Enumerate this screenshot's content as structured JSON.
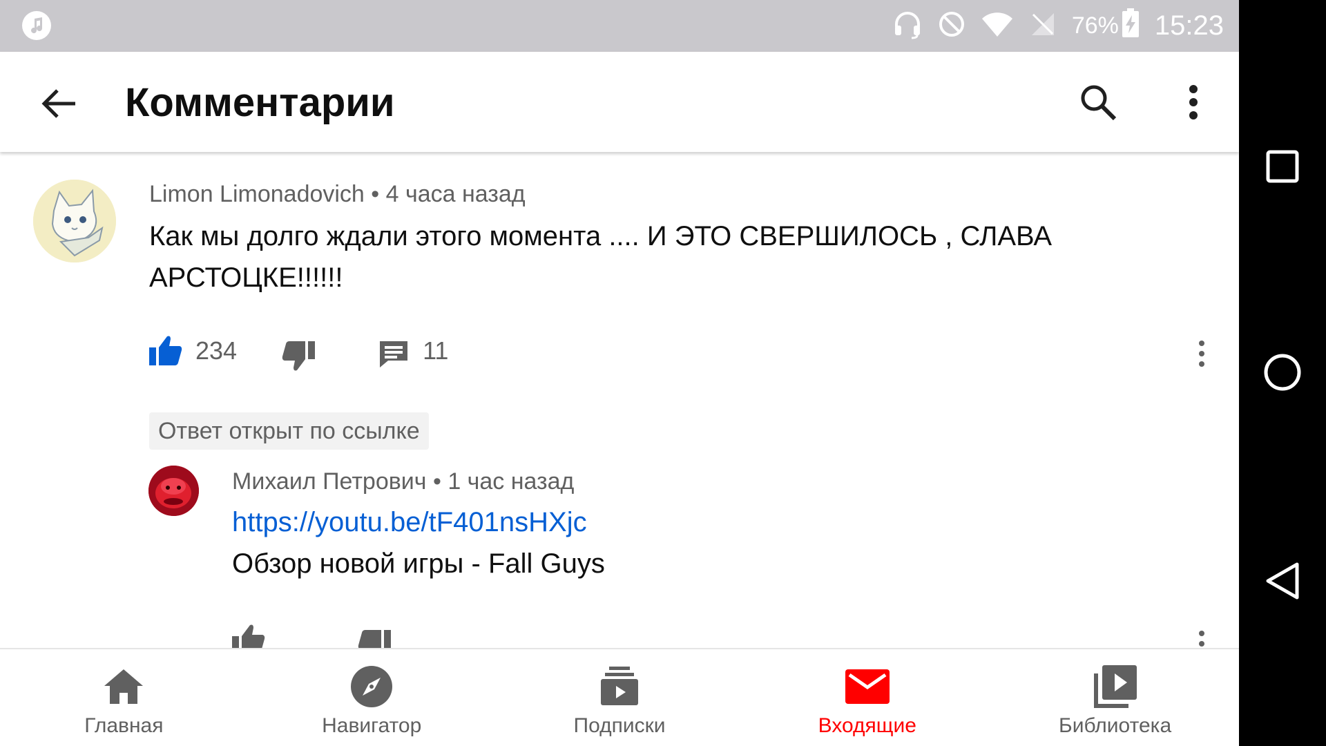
{
  "status_bar": {
    "battery": "76%",
    "time": "15:23"
  },
  "app_bar": {
    "title": "Комментарии"
  },
  "comment": {
    "author": "Limon Limonadovich",
    "time": "4 часа назад",
    "text": "Как мы долго ждали этого момента .... И ЭТО СВЕРШИЛОСЬ , СЛАВА АРСТОЦКЕ!!!!!!",
    "likes": "234",
    "replies": "11",
    "liked": true
  },
  "reply_chip": "Ответ открыт по ссылке",
  "reply": {
    "author": "Михаил Петрович",
    "time": "1 час назад",
    "link": "https://youtu.be/tF401nsHXjc",
    "text": "Обзор новой игры - Fall Guys"
  },
  "bottom_nav": {
    "tabs": [
      {
        "label": "Главная",
        "icon": "home-icon",
        "active": false
      },
      {
        "label": "Навигатор",
        "icon": "compass-icon",
        "active": false
      },
      {
        "label": "Подписки",
        "icon": "subscriptions-icon",
        "active": false
      },
      {
        "label": "Входящие",
        "icon": "inbox-icon",
        "active": true
      },
      {
        "label": "Библиотека",
        "icon": "library-icon",
        "active": false
      }
    ]
  },
  "colors": {
    "accent_red": "#ff0000",
    "like_blue": "#065fd4",
    "link_blue": "#065fd4",
    "secondary_text": "#606060",
    "status_bar_bg": "#c9c8cc"
  }
}
